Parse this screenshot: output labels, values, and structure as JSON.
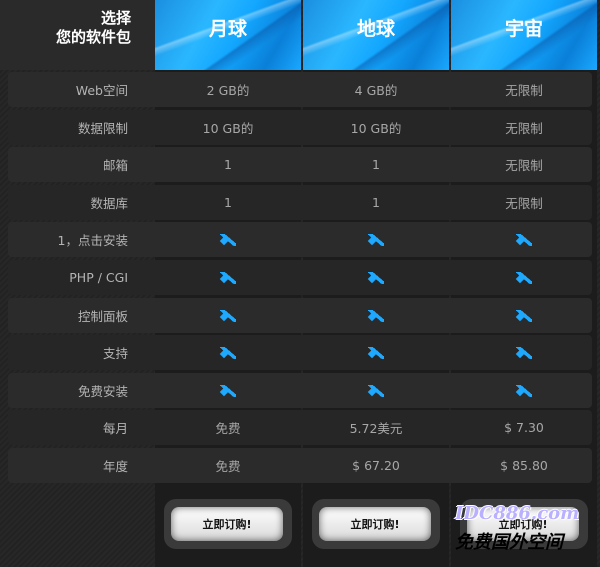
{
  "header": {
    "title_line1": "选择",
    "title_line2": "您的软件包"
  },
  "plans": [
    {
      "name": "月球",
      "button_label": "立即订购!"
    },
    {
      "name": "地球",
      "button_label": "立即订购!"
    },
    {
      "name": "宇宙",
      "button_label": "立即订购!"
    }
  ],
  "rows": [
    {
      "label": "Web空间",
      "values": [
        "2 GB的",
        "4 GB的",
        "无限制"
      ]
    },
    {
      "label": "数据限制",
      "values": [
        "10 GB的",
        "10 GB的",
        "无限制"
      ]
    },
    {
      "label": "邮箱",
      "values": [
        "1",
        "1",
        "无限制"
      ]
    },
    {
      "label": "数据库",
      "values": [
        "1",
        "1",
        "无限制"
      ]
    },
    {
      "label": "1，点击安装",
      "values": [
        "check",
        "check",
        "check"
      ]
    },
    {
      "label": "PHP / CGI",
      "values": [
        "check",
        "check",
        "check"
      ]
    },
    {
      "label": "控制面板",
      "values": [
        "check",
        "check",
        "check"
      ]
    },
    {
      "label": "支持",
      "values": [
        "check",
        "check",
        "check"
      ]
    },
    {
      "label": "免费安装",
      "values": [
        "check",
        "check",
        "check"
      ]
    },
    {
      "label": "每月",
      "values": [
        "免费",
        "5.72美元",
        "$ 7.30"
      ]
    },
    {
      "label": "年度",
      "values": [
        "免费",
        "$ 67.20",
        "$ 85.80"
      ]
    }
  ],
  "watermark": {
    "line1": "IDC886.com",
    "line2": "免费国外空间"
  },
  "colors": {
    "check": "#1ea9ff",
    "header_blue": "#1aa8ff"
  },
  "icons": {
    "check": "check-icon"
  }
}
